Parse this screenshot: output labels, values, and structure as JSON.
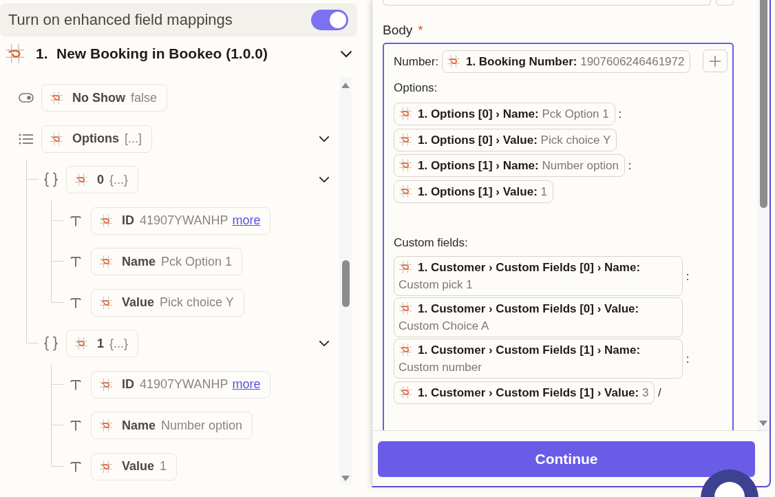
{
  "enhanced_mappings": {
    "label": "Turn on enhanced field mappings",
    "on": true
  },
  "step": {
    "number": "1.",
    "title": "New Booking in Bookeo (1.0.0)",
    "expanded": true
  },
  "tree": [
    {
      "kind": "boolean",
      "label": "No Show",
      "value": "false"
    },
    {
      "kind": "list",
      "label": "Options",
      "value": "[...]",
      "expanded": true,
      "children": [
        {
          "kind": "object",
          "label": "0",
          "value": "{...}",
          "expanded": true,
          "children": [
            {
              "kind": "text",
              "label": "ID",
              "value": "41907YWANHP",
              "link": "more"
            },
            {
              "kind": "text",
              "label": "Name",
              "value": "Pck Option 1"
            },
            {
              "kind": "text",
              "label": "Value",
              "value": "Pick choice Y"
            }
          ]
        },
        {
          "kind": "object",
          "label": "1",
          "value": "{...}",
          "expanded": true,
          "children": [
            {
              "kind": "text",
              "label": "ID",
              "value": "41907YWANHP",
              "link": "more"
            },
            {
              "kind": "text",
              "label": "Name",
              "value": "Number option"
            },
            {
              "kind": "text",
              "label": "Value",
              "value": "1"
            }
          ]
        }
      ]
    }
  ],
  "body_field": {
    "label": "Body",
    "required_marker": "*",
    "content": [
      {
        "kind": "text",
        "text": "Number:"
      },
      {
        "kind": "chip",
        "label": "1. Booking Number:",
        "value": "1907606246461972"
      },
      {
        "kind": "break"
      },
      {
        "kind": "text",
        "text": "Options:"
      },
      {
        "kind": "break"
      },
      {
        "kind": "chip",
        "label": "1. Options [0] › Name:",
        "value": "Pck Option 1"
      },
      {
        "kind": "text",
        "text": ":"
      },
      {
        "kind": "chip",
        "label": "1. Options [0] › Value:",
        "value": "Pick choice Y"
      },
      {
        "kind": "break"
      },
      {
        "kind": "chip",
        "label": "1. Options [1] › Name:",
        "value": "Number option"
      },
      {
        "kind": "text",
        "text": ":"
      },
      {
        "kind": "chip",
        "label": "1. Options [1] › Value:",
        "value": "1"
      },
      {
        "kind": "break"
      },
      {
        "kind": "break"
      },
      {
        "kind": "text",
        "text": "Custom fields:"
      },
      {
        "kind": "break"
      },
      {
        "kind": "chip",
        "label": "1. Customer › Custom Fields [0] › Name:",
        "value": "Custom pick 1"
      },
      {
        "kind": "text",
        "text": ":"
      },
      {
        "kind": "chip",
        "label": "1. Customer › Custom Fields [0] › Value:",
        "value": "Custom Choice A"
      },
      {
        "kind": "break"
      },
      {
        "kind": "chip",
        "label": "1. Customer › Custom Fields [1] › Name:",
        "value": "Custom number"
      },
      {
        "kind": "text",
        "text": ":"
      },
      {
        "kind": "chip",
        "label": "1. Customer › Custom Fields [1] › Value:",
        "value": "3"
      },
      {
        "kind": "text",
        "text": "/"
      }
    ]
  },
  "footer": {
    "continue_button": "Continue"
  }
}
